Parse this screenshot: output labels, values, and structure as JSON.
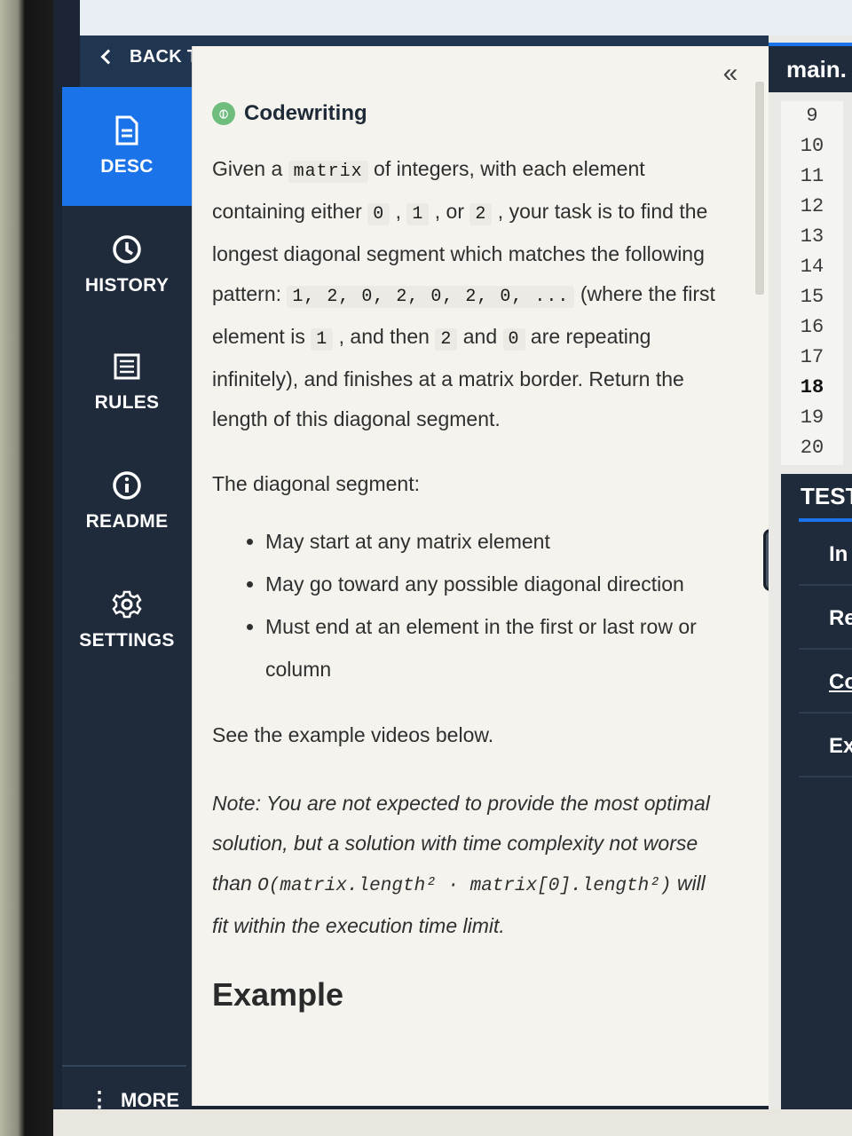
{
  "header": {
    "back_label": "BACK TO QUESTIONS"
  },
  "sidebar": {
    "items": [
      {
        "label": "DESC",
        "icon": "document-icon",
        "active": true
      },
      {
        "label": "HISTORY",
        "icon": "clock-icon",
        "active": false
      },
      {
        "label": "RULES",
        "icon": "list-icon",
        "active": false
      },
      {
        "label": "README",
        "icon": "info-icon",
        "active": false
      },
      {
        "label": "SETTINGS",
        "icon": "gear-icon",
        "active": false
      }
    ],
    "more_label": "MORE"
  },
  "description": {
    "collapse_glyph": "«",
    "title": "Codewriting",
    "p1_a": "Given a ",
    "p1_code1": "matrix",
    "p1_b": " of integers, with each element containing either ",
    "p1_code2": "0",
    "p1_c": " , ",
    "p1_code3": "1",
    "p1_d": " , or ",
    "p1_code4": "2",
    "p1_e": " , your task is to find the longest diagonal segment which matches the following pattern: ",
    "p1_code5": "1, 2, 0, 2, 0, 2, 0, ...",
    "p1_f": " (where the first element is ",
    "p1_code6": "1",
    "p1_g": " , and then ",
    "p1_code7": "2",
    "p1_h": " and ",
    "p1_code8": "0",
    "p1_i": " are repeating infinitely), and finishes at a matrix border. Return the length of this diagonal segment.",
    "p2": "The diagonal segment:",
    "bullets": [
      "May start at any matrix element",
      "May go toward any possible diagonal direction",
      "Must end at an element in the first or last row or column"
    ],
    "p3": "See the example videos below.",
    "note_a": "Note: You are not expected to provide the most optimal solution, but a solution with time complexity not worse than ",
    "note_code1": "O(matrix.length² · matrix[0].length²)",
    "note_b": " will fit within the execution time limit.",
    "example_heading": "Example"
  },
  "editor": {
    "tab_label": "main.",
    "line_numbers": [
      "9",
      "10",
      "11",
      "12",
      "13",
      "14",
      "15",
      "16",
      "17",
      "18",
      "19",
      "20"
    ],
    "current_line": "18"
  },
  "tests": {
    "title": "TEST",
    "rows": [
      "In",
      "Re",
      "Co",
      "Ex"
    ]
  },
  "colors": {
    "accent": "#1a73e8",
    "sidebar": "#1f2b3b",
    "panel": "#f4f3ee"
  }
}
